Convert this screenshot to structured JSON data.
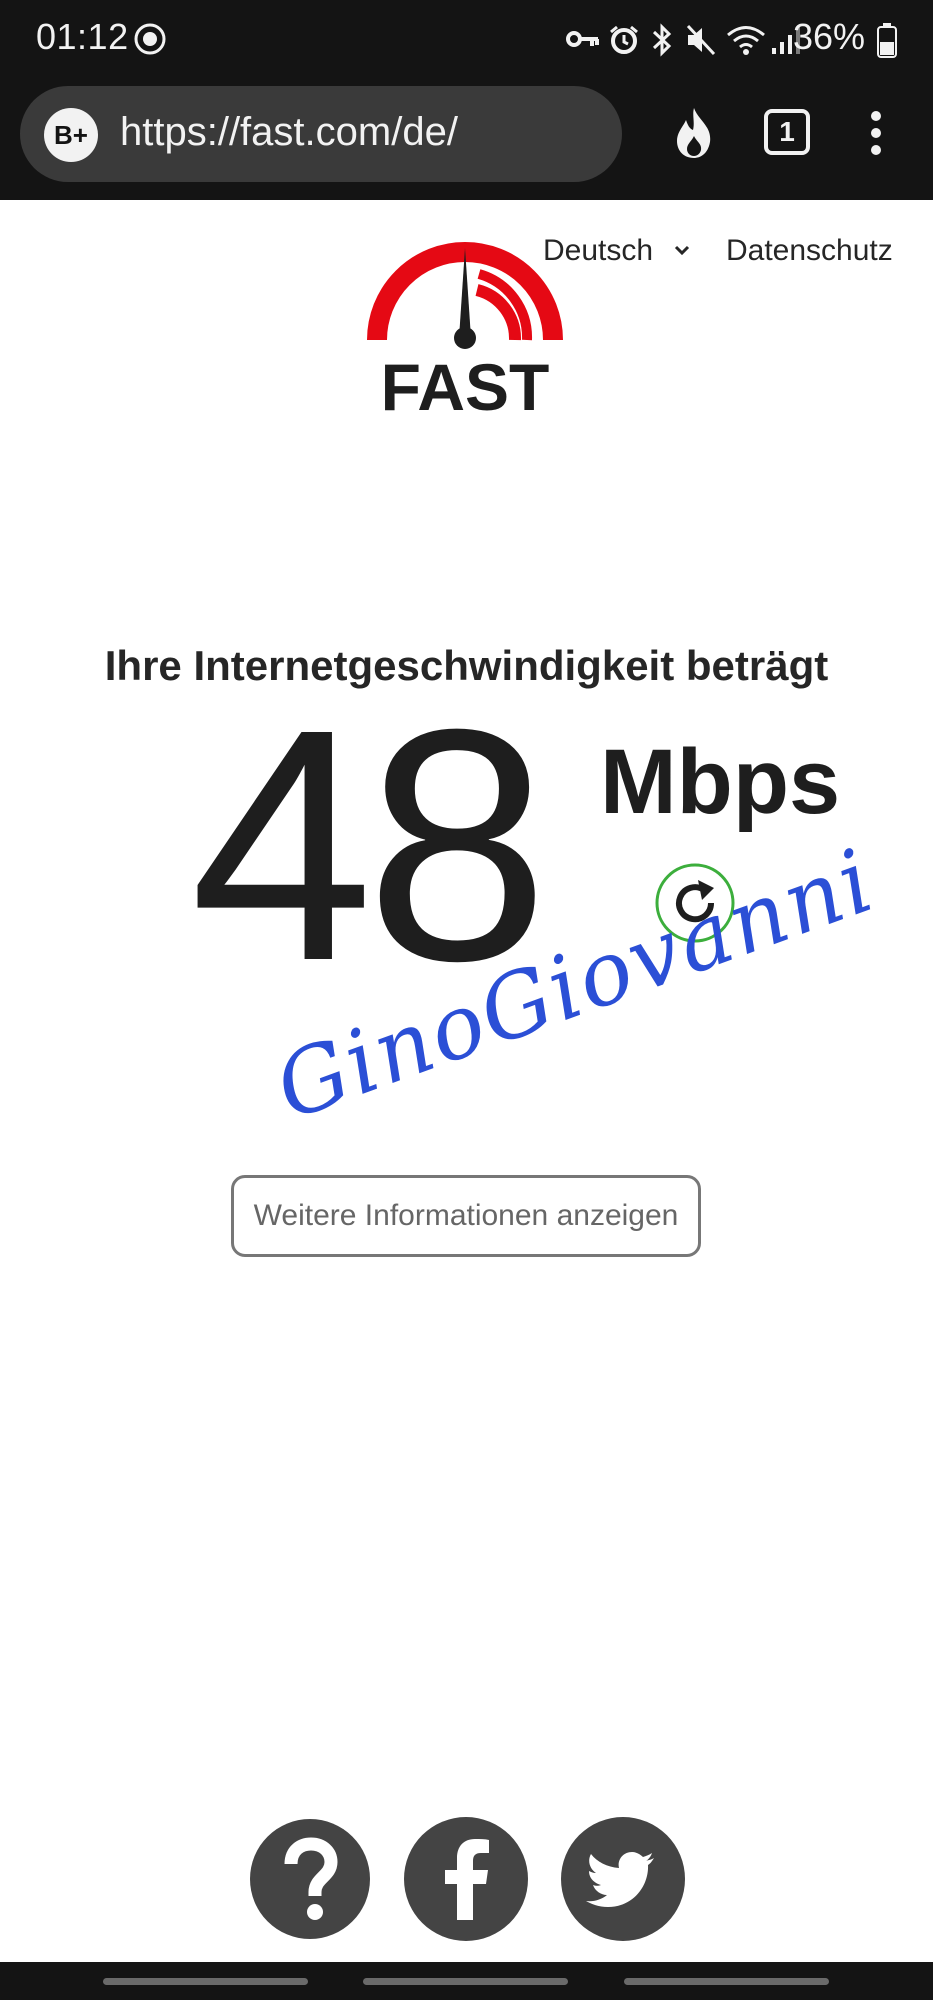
{
  "status_bar": {
    "time": "01:12",
    "battery": "36%",
    "icons": [
      "messenger-icon",
      "vpn-key-icon",
      "alarm-icon",
      "bluetooth-icon",
      "mute-icon",
      "wifi-icon",
      "signal-icon",
      "battery-icon"
    ]
  },
  "browser": {
    "site_badge": "B+",
    "url": "https://fast.com/de/",
    "tabs_count": "1",
    "icons": [
      "flame-icon",
      "tabs-icon",
      "more-vert-icon"
    ]
  },
  "header": {
    "logo_text": "FAST",
    "language": "Deutsch",
    "privacy": "Datenschutz"
  },
  "result": {
    "title": "Ihre Internetgeschwindigkeit beträgt",
    "value": "48",
    "unit": "Mbps"
  },
  "watermark": "GinoGiovanni",
  "more_info_button": "Weitere Informationen anzeigen",
  "footer": {
    "icons": [
      "help-icon",
      "facebook-icon",
      "twitter-icon"
    ]
  },
  "colors": {
    "accent": "#e50914",
    "dark_bar": "#141414",
    "text": "#1e1e1e",
    "social_bg": "#444444",
    "watermark": "#2b4fd6",
    "refresh_ring": "#3cae3c"
  }
}
